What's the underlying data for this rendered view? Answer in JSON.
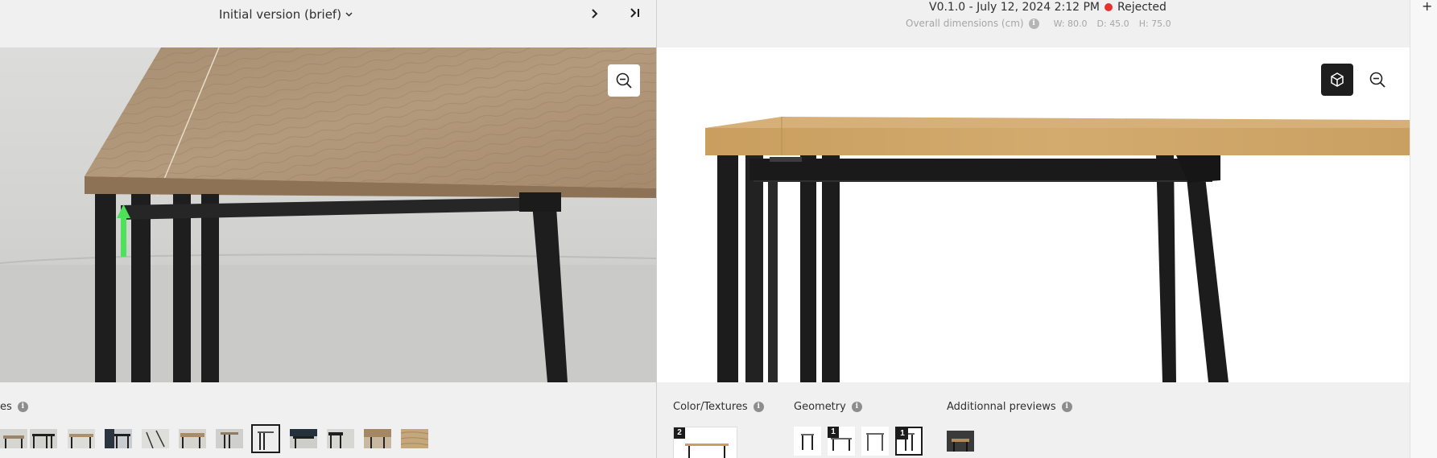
{
  "left": {
    "version_label": "Initial version (brief)",
    "chevron_glyph": "⌄",
    "next_glyph": "›",
    "last_glyph": "›|",
    "section_label": "es",
    "icons": {
      "zoom": "zoom-out-icon",
      "info": "info-icon"
    },
    "thumbnail_count": 12,
    "selected_thumbnail": 7
  },
  "right": {
    "version_text": "V0.1.0 - July 12, 2024 2:12 PM",
    "status_text": "Rejected",
    "status_color": "#e5322d",
    "dims_label": "Overall dimensions (cm)",
    "width": "W: 80.0",
    "depth": "D: 45.0",
    "height": "H: 75.0",
    "sections": {
      "colors": "Color/Textures",
      "geometry": "Geometry",
      "additional": "Additionnal previews"
    },
    "badges": {
      "colors": "2",
      "geometry_2": "1",
      "geometry_4": "1"
    },
    "icons": {
      "view_3d": "cube-icon",
      "zoom": "zoom-out-icon"
    }
  },
  "edge": {
    "plus_glyph": "+"
  },
  "colors": {
    "status_rejected": "#e5322d",
    "wood": "#b5926a",
    "wood_right": "#c9a46b",
    "frame": "#1c1c1c"
  }
}
